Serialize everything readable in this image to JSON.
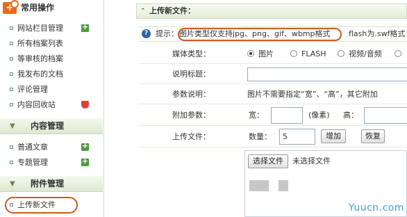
{
  "sidebar": {
    "groups": [
      {
        "title": "常用操作",
        "items": [
          "网站栏目管理",
          "所有档案列表",
          "等审核的档案",
          "我发布的文档",
          "评论管理",
          "内容回收站"
        ]
      },
      {
        "title": "内容管理",
        "items": [
          "普通文章",
          "专题管理"
        ]
      },
      {
        "title": "附件管理",
        "items": [
          "上传新文件"
        ]
      }
    ],
    "active_item": "上传新文件"
  },
  "main": {
    "header_title": "上传新文件：",
    "tip": {
      "prefix": "提示：",
      "text": "图片类型仅支持jpg、png、gif、wbmp格式",
      "suffix": "flash为.swf格式"
    },
    "form": {
      "media_type": {
        "label": "媒体类型：",
        "options": [
          "图片",
          "FLASH",
          "视频/音频"
        ],
        "selected": "图片"
      },
      "title_field": {
        "label": "说明标题：",
        "value": ""
      },
      "param_desc": {
        "label": "参数说明：",
        "text": "图片不需要指定“宽”、“高”，其它附加"
      },
      "extra_params": {
        "label": "附加参数：",
        "width_label": "宽：",
        "width_unit": "(像素)",
        "height_label": "高："
      },
      "upload_files": {
        "label": "上传文件：",
        "count_label": "数量：",
        "count_value": "5",
        "add_button": "增加",
        "reset_button": "恢复"
      },
      "file_picker": {
        "button": "选择文件",
        "status": "未选择文件"
      }
    }
  },
  "watermark": "Yuucn.com"
}
